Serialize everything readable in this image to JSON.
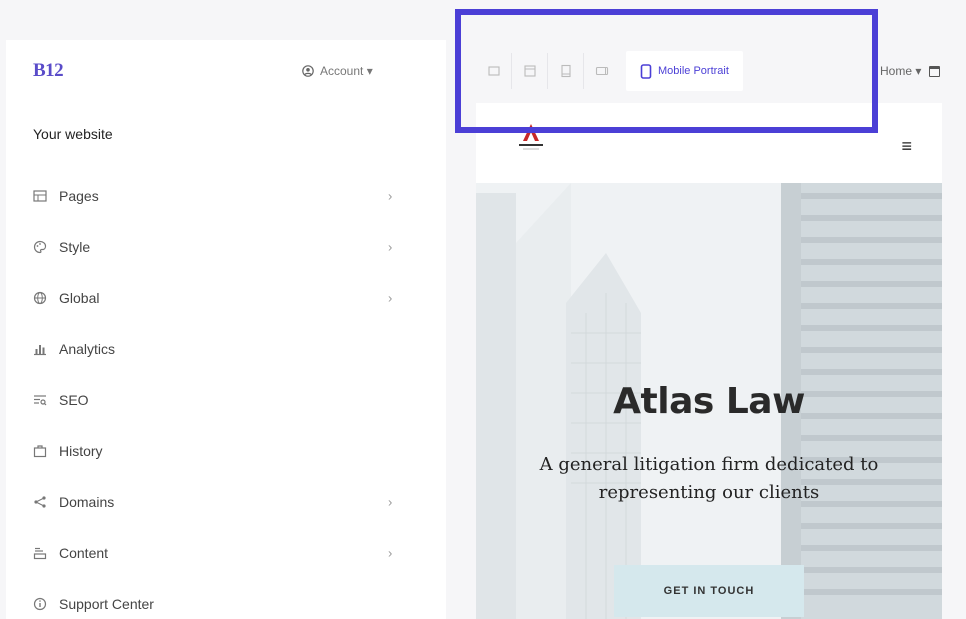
{
  "sidebar": {
    "brand": "B12",
    "account_label": "Account ▾",
    "heading": "Your website",
    "items": [
      {
        "label": "Pages",
        "icon": "pages-icon",
        "chevron": "›"
      },
      {
        "label": "Style",
        "icon": "palette-icon",
        "chevron": "›"
      },
      {
        "label": "Global",
        "icon": "globe-icon",
        "chevron": "›"
      },
      {
        "label": "Analytics",
        "icon": "bar-chart-icon"
      },
      {
        "label": "SEO",
        "icon": "seo-icon"
      },
      {
        "label": "History",
        "icon": "history-icon"
      },
      {
        "label": "Domains",
        "icon": "share-icon",
        "chevron": "›"
      },
      {
        "label": "Content",
        "icon": "content-icon",
        "chevron": "›"
      },
      {
        "label": "Support Center",
        "icon": "info-icon"
      }
    ]
  },
  "toolbar": {
    "active_device": "Mobile Portrait",
    "devices": [
      "desktop-icon",
      "laptop-icon",
      "tablet-portrait-icon",
      "tablet-landscape-icon"
    ],
    "page_select": "Home ▾",
    "accent": "#4b3fd6"
  },
  "preview": {
    "title": "Atlas Law",
    "subtitle": "A general litigation firm dedicated to representing our clients",
    "cta": "GET IN TOUCH",
    "menu_icon": "≡"
  }
}
